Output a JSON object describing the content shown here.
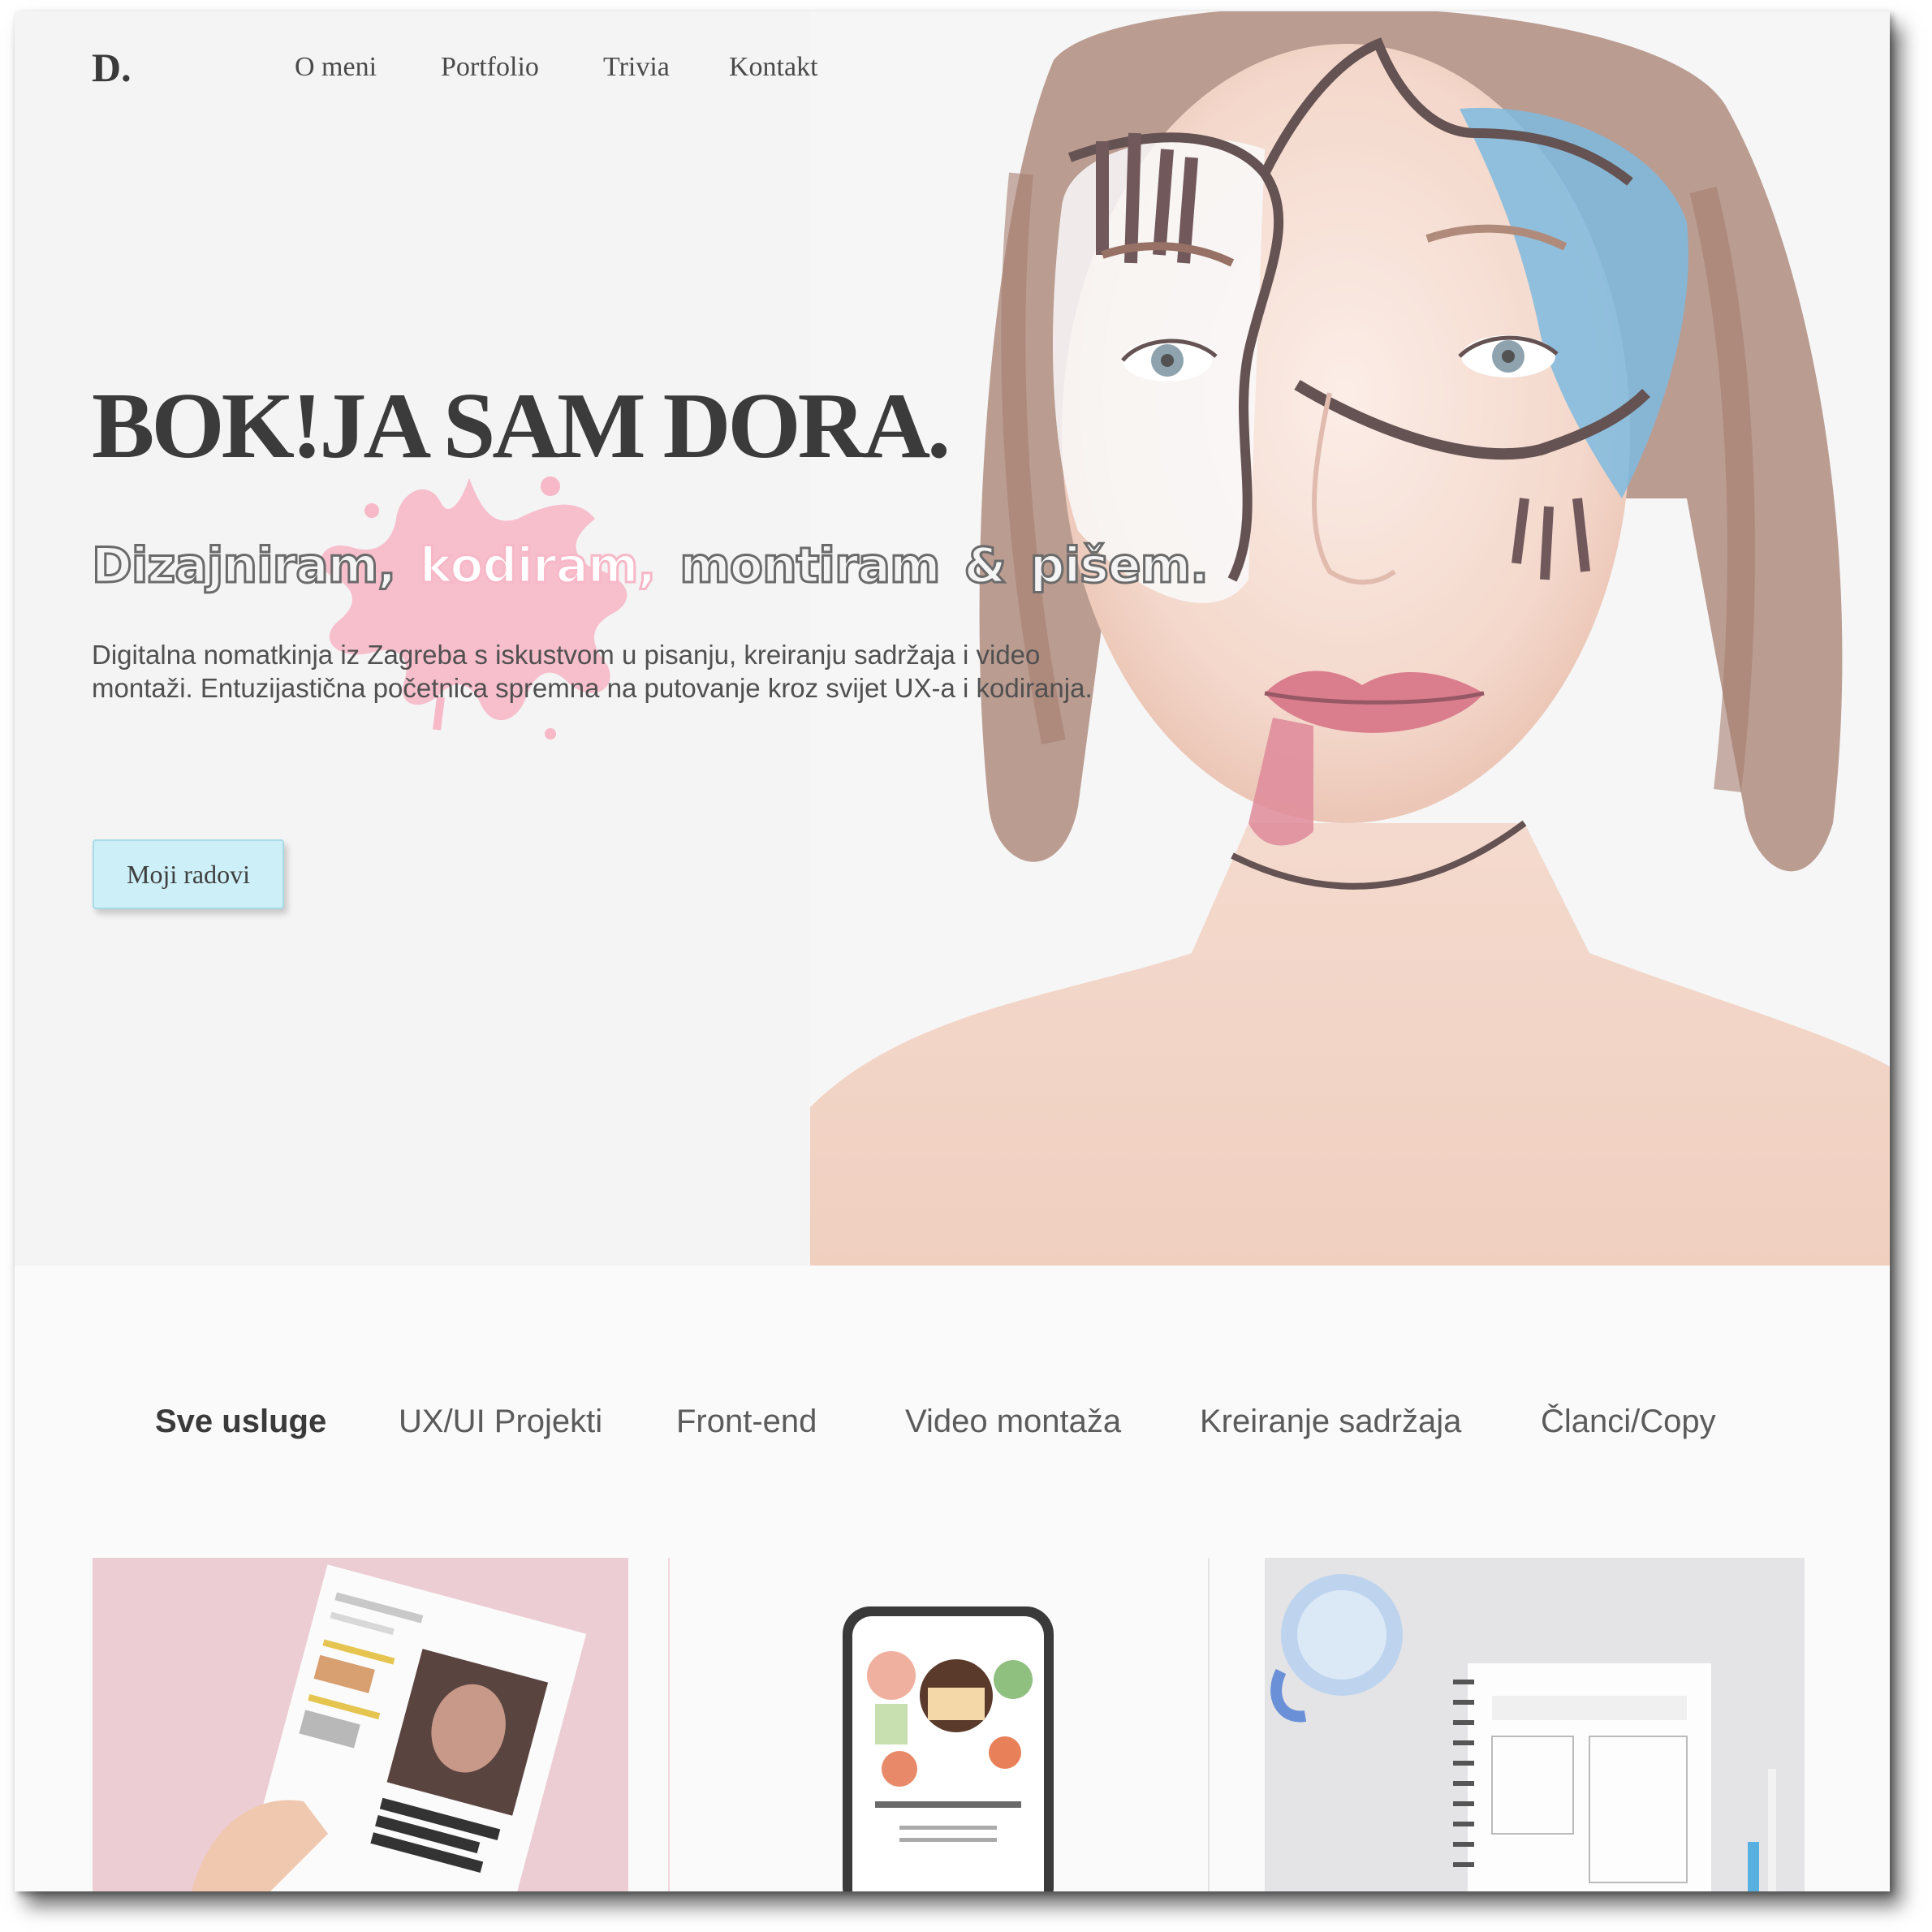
{
  "brand": {
    "logo": "D."
  },
  "nav": {
    "items": [
      "O meni",
      "Portfolio",
      "Trivia",
      "Kontakt"
    ]
  },
  "hero": {
    "headline": "BOK!JA SAM DORA.",
    "subheadline_words": [
      "Dizajniram,",
      "kodiram,",
      "montiram",
      "&",
      "pišem."
    ],
    "intro": "Digitalna nomatkinja iz Zagreba s iskustvom u pisanju, kreiranju sadržaja i video montaži. Entuzijastična početnica spremna na putovanje kroz svijet UX-a i kodiranja.",
    "cta_label": "Moji radovi"
  },
  "services": {
    "tabs": [
      "Sve usluge",
      "UX/UI Projekti",
      "Front-end",
      "Video montaža",
      "Kreiranje sadržaja",
      "Članci/Copy"
    ],
    "active_tab": "Sve usluge"
  },
  "colors": {
    "accent_pink": "#f7b8c8",
    "cta_blue": "#cdeff7",
    "text_dark": "#3b3b3b"
  }
}
